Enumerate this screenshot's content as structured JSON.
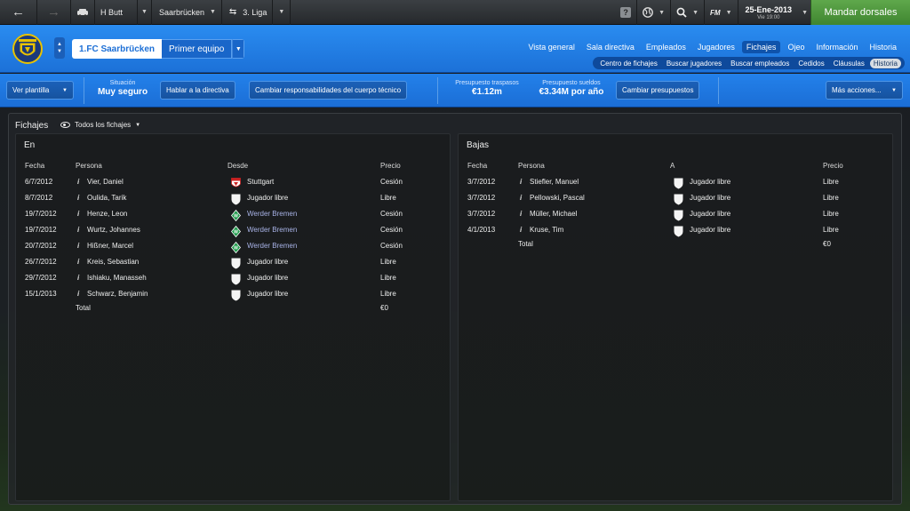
{
  "topbar": {
    "manager_name": "H Butt",
    "club_name": "Saarbrücken",
    "league_name": "3. Liga",
    "fm_label": "FM",
    "date": "25-Ene-2013",
    "date_sub": "Vie 19:00",
    "continue_label": "Mandar dorsales"
  },
  "club": {
    "name": "1.FC Saarbrücken",
    "team": "Primer equipo"
  },
  "main_nav": [
    {
      "label": "Vista general"
    },
    {
      "label": "Sala directiva"
    },
    {
      "label": "Empleados"
    },
    {
      "label": "Jugadores"
    },
    {
      "label": "Fichajes"
    },
    {
      "label": "Ojeo"
    },
    {
      "label": "Información"
    },
    {
      "label": "Historia"
    }
  ],
  "sub_nav": [
    {
      "label": "Centro de fichajes"
    },
    {
      "label": "Buscar jugadores"
    },
    {
      "label": "Buscar empleados"
    },
    {
      "label": "Cedidos"
    },
    {
      "label": "Cláusulas"
    },
    {
      "label": "Historia"
    }
  ],
  "toolbar": {
    "squad_button": "Ver plantilla",
    "status_label": "Situación",
    "status_value": "Muy seguro",
    "board_button": "Hablar a la directiva",
    "staff_button": "Cambiar responsabilidades del cuerpo técnico",
    "transfer_budget_label": "Presupuesto traspasos",
    "transfer_budget_value": "€1.12m",
    "wage_budget_label": "Presupuesto sueldos",
    "wage_budget_value": "€3.34M por año",
    "change_budget_button": "Cambiar presupuestos",
    "more_actions_button": "Más acciones..."
  },
  "content": {
    "title": "Fichajes",
    "filter": "Todos los fichajes"
  },
  "transfers_in": {
    "title": "En",
    "headers": {
      "date": "Fecha",
      "person": "Persona",
      "from": "Desde",
      "fee": "Precio"
    },
    "rows": [
      {
        "date": "6/7/2012",
        "person": "Vier, Daniel",
        "club": "Stuttgart",
        "fee": "Cesión"
      },
      {
        "date": "8/7/2012",
        "person": "Oulida, Tarik",
        "club": "Jugador libre",
        "fee": "Libre"
      },
      {
        "date": "19/7/2012",
        "person": "Henze, Leon",
        "club": "Werder Bremen",
        "fee": "Cesión"
      },
      {
        "date": "19/7/2012",
        "person": "Wurtz, Johannes",
        "club": "Werder Bremen",
        "fee": "Cesión"
      },
      {
        "date": "20/7/2012",
        "person": "Hißner, Marcel",
        "club": "Werder Bremen",
        "fee": "Cesión"
      },
      {
        "date": "26/7/2012",
        "person": "Kreis, Sebastian",
        "club": "Jugador libre",
        "fee": "Libre"
      },
      {
        "date": "29/7/2012",
        "person": "Ishiaku, Manasseh",
        "club": "Jugador libre",
        "fee": "Libre"
      },
      {
        "date": "15/1/2013",
        "person": "Schwarz, Benjamin",
        "club": "Jugador libre",
        "fee": "Libre"
      }
    ],
    "total_label": "Total",
    "total_value": "€0"
  },
  "transfers_out": {
    "title": "Bajas",
    "headers": {
      "date": "Fecha",
      "person": "Persona",
      "to": "A",
      "fee": "Precio"
    },
    "rows": [
      {
        "date": "3/7/2012",
        "person": "Stiefler, Manuel",
        "club": "Jugador libre",
        "fee": "Libre"
      },
      {
        "date": "3/7/2012",
        "person": "Pellowski, Pascal",
        "club": "Jugador libre",
        "fee": "Libre"
      },
      {
        "date": "3/7/2012",
        "person": "Müller, Michael",
        "club": "Jugador libre",
        "fee": "Libre"
      },
      {
        "date": "4/1/2013",
        "person": "Kruse, Tim",
        "club": "Jugador libre",
        "fee": "Libre"
      }
    ],
    "total_label": "Total",
    "total_value": "€0"
  },
  "info_marker": "i",
  "colors": {
    "club_blue": "#1c71d8",
    "continue_green": "#4f9a3e",
    "club_link": "#a9b3e8"
  }
}
